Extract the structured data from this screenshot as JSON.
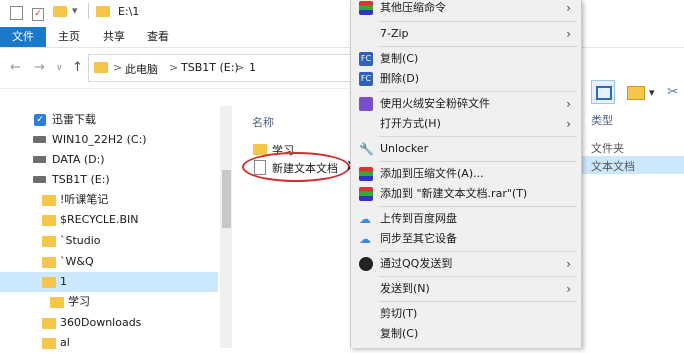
{
  "titlebar": {
    "path": "E:\\1"
  },
  "ribbon": {
    "tabs": [
      "文件",
      "主页",
      "共享",
      "查看"
    ]
  },
  "address": {
    "crumbs": [
      "此电脑",
      "TSB1T (E:)",
      "1"
    ],
    "sep": ">"
  },
  "nav": {
    "items": [
      {
        "label": "迅雷下载",
        "icon": "thunder-icon"
      },
      {
        "label": "WIN10_22H2 (C:)",
        "icon": "drive-icon"
      },
      {
        "label": "DATA (D:)",
        "icon": "drive-icon"
      },
      {
        "label": "TSB1T (E:)",
        "icon": "drive-icon"
      },
      {
        "label": "!听课笔记",
        "icon": "folder-icon"
      },
      {
        "label": "$RECYCLE.BIN",
        "icon": "folder-icon"
      },
      {
        "label": "`Studio",
        "icon": "folder-icon"
      },
      {
        "label": "`W&Q",
        "icon": "folder-icon"
      },
      {
        "label": "1",
        "icon": "folder-icon",
        "selected": true
      },
      {
        "label": "学习",
        "icon": "folder-icon"
      },
      {
        "label": "360Downloads",
        "icon": "folder-icon"
      },
      {
        "label": "al",
        "icon": "folder-icon"
      }
    ]
  },
  "filelist": {
    "header": "名称",
    "items": [
      {
        "label": "学习",
        "icon": "folder-icon"
      },
      {
        "label": "新建文本文档",
        "icon": "text-file-icon"
      }
    ]
  },
  "context_menu": {
    "items": [
      {
        "label": "其他压缩命令",
        "arrow": true
      },
      {
        "label": "7-Zip",
        "arrow": true
      },
      {
        "label": "复制(C)"
      },
      {
        "label": "删除(D)"
      },
      {
        "label": "使用火绒安全粉碎文件",
        "arrow": true
      },
      {
        "label": "打开方式(H)",
        "arrow": true
      },
      {
        "label": "Unlocker"
      },
      {
        "label": "添加到压缩文件(A)..."
      },
      {
        "label": "添加到 \"新建文本文档.rar\"(T)"
      },
      {
        "label": "上传到百度网盘"
      },
      {
        "label": "同步至其它设备"
      },
      {
        "label": "通过QQ发送到",
        "arrow": true
      },
      {
        "label": "发送到(N)",
        "arrow": true
      },
      {
        "label": "剪切(T)"
      },
      {
        "label": "复制(C)"
      }
    ],
    "arrow_glyph": "›"
  },
  "right": {
    "header": "类型",
    "types": [
      "文件夹",
      "文本文档"
    ]
  },
  "colors": {
    "accent": "#1979ca",
    "selection": "#cce8ff",
    "menu_bg": "#f0f0f0",
    "folder": "#f4c64a"
  }
}
